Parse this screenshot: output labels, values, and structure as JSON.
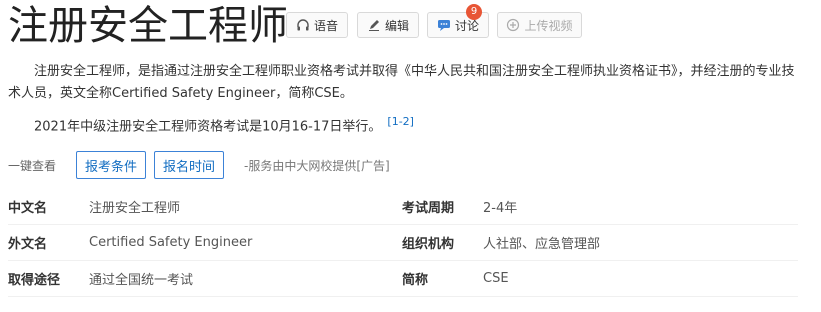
{
  "header": {
    "title": "注册安全工程师",
    "buttons": {
      "voice": "语音",
      "edit": "编辑",
      "discuss": "讨论",
      "discuss_badge": "9",
      "upload_video": "上传视频"
    }
  },
  "intro": {
    "paragraph1": "注册安全工程师，是指通过注册安全工程师职业资格考试并取得《中华人民共和国注册安全工程师执业资格证书》，并经注册的专业技术人员，英文全称Certified Safety Engineer，简称CSE。",
    "paragraph2": "2021年中级注册安全工程师资格考试是10月16-17日举行。",
    "ref": "[1-2]"
  },
  "quick": {
    "label": "一键查看",
    "button1": "报考条件",
    "button2": "报名时间",
    "note": "-服务由中大网校提供[广告]"
  },
  "info": [
    {
      "name": "中文名",
      "value": "注册安全工程师",
      "name2": "考试周期",
      "value2": "2-4年"
    },
    {
      "name": "外文名",
      "value": "Certified Safety Engineer",
      "name2": "组织机构",
      "value2": "人社部、应急管理部"
    },
    {
      "name": "取得途径",
      "value": "通过全国统一考试",
      "name2": "简称",
      "value2": "CSE"
    }
  ],
  "colors": {
    "accent": "#136ec2",
    "badge": "#e85535"
  }
}
